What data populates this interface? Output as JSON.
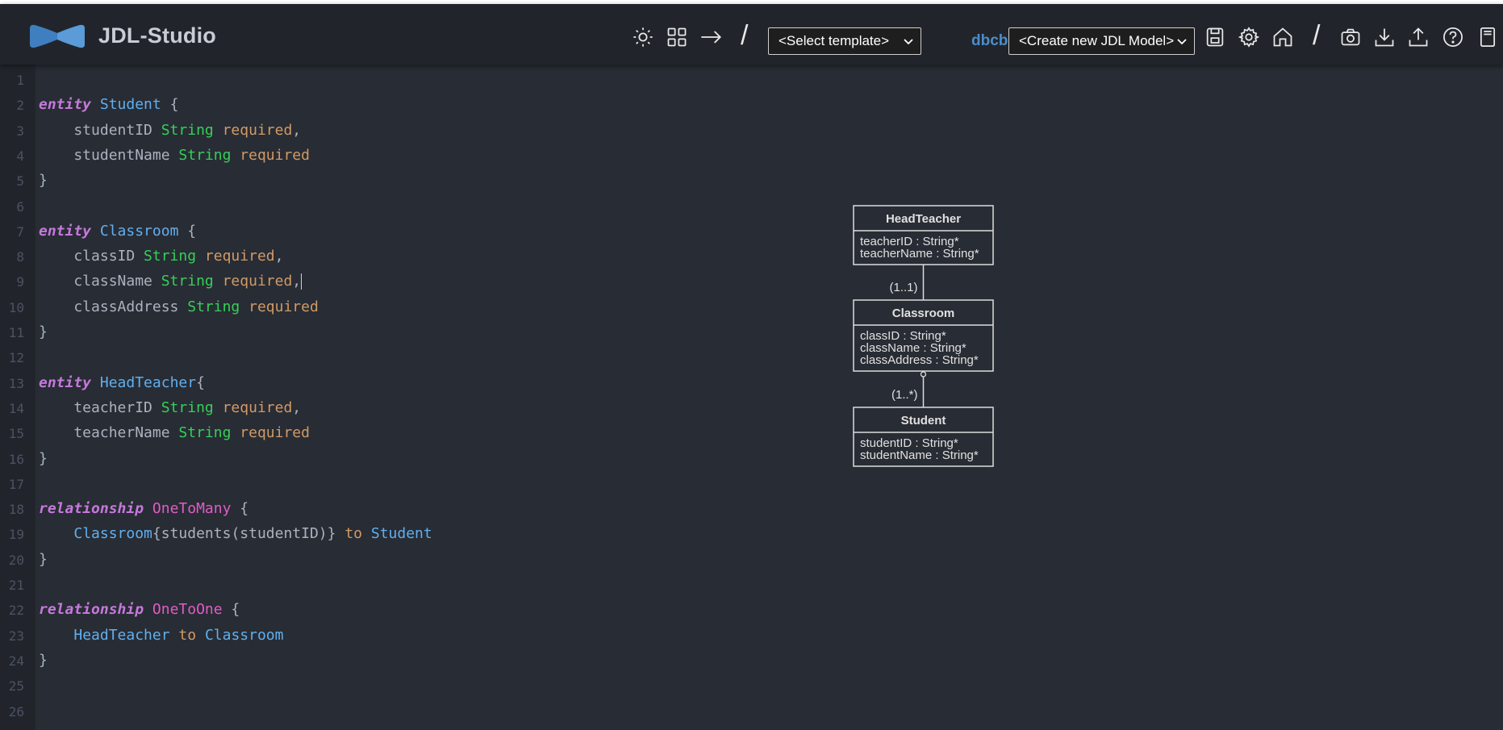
{
  "app": {
    "title": "JDL-Studio"
  },
  "toolbar": {
    "icons": [
      "sun-icon",
      "grid-icon",
      "arrow-right-icon"
    ],
    "template_select": "<Select template>",
    "user": "dbcb",
    "model_select": "<Create new JDL Model>",
    "right_icons": [
      "save-icon",
      "settings-icon",
      "home-icon",
      "camera-icon",
      "download-icon",
      "upload-icon",
      "help-icon",
      "sidebar-icon"
    ],
    "colors": {
      "header_bg": "#21252b",
      "editor_bg": "#282c34",
      "accent": "#4b8ecc"
    }
  },
  "editor": {
    "line_numbers": [
      "1",
      "2",
      "3",
      "4",
      "5",
      "6",
      "7",
      "8",
      "9",
      "10",
      "11",
      "12",
      "13",
      "14",
      "15",
      "16",
      "17",
      "18",
      "19",
      "20",
      "21",
      "22",
      "23",
      "24",
      "25",
      "26"
    ],
    "lines": [
      [],
      [
        {
          "t": "entity",
          "c": "kw"
        },
        {
          "t": " "
        },
        {
          "t": "Student",
          "c": "ent"
        },
        {
          "t": " {",
          "c": "br"
        }
      ],
      [
        {
          "t": "    studentID "
        },
        {
          "t": "String",
          "c": "typ"
        },
        {
          "t": " "
        },
        {
          "t": "required",
          "c": "req"
        },
        {
          "t": ","
        }
      ],
      [
        {
          "t": "    studentName "
        },
        {
          "t": "String",
          "c": "typ"
        },
        {
          "t": " "
        },
        {
          "t": "required",
          "c": "req"
        }
      ],
      [
        {
          "t": "}"
        }
      ],
      [],
      [
        {
          "t": "entity",
          "c": "kw"
        },
        {
          "t": " "
        },
        {
          "t": "Classroom",
          "c": "ent"
        },
        {
          "t": " {",
          "c": "br"
        }
      ],
      [
        {
          "t": "    classID "
        },
        {
          "t": "String",
          "c": "typ"
        },
        {
          "t": " "
        },
        {
          "t": "required",
          "c": "req"
        },
        {
          "t": ","
        }
      ],
      [
        {
          "t": "    className "
        },
        {
          "t": "String",
          "c": "typ"
        },
        {
          "t": " "
        },
        {
          "t": "required",
          "c": "req"
        },
        {
          "t": ","
        },
        {
          "cursor": true
        }
      ],
      [
        {
          "t": "    classAddress "
        },
        {
          "t": "String",
          "c": "typ"
        },
        {
          "t": " "
        },
        {
          "t": "required",
          "c": "req"
        }
      ],
      [
        {
          "t": "}"
        }
      ],
      [],
      [
        {
          "t": "entity",
          "c": "kw"
        },
        {
          "t": " "
        },
        {
          "t": "HeadTeacher",
          "c": "ent"
        },
        {
          "t": "{",
          "c": "br"
        }
      ],
      [
        {
          "t": "    teacherID "
        },
        {
          "t": "String",
          "c": "typ"
        },
        {
          "t": " "
        },
        {
          "t": "required",
          "c": "req"
        },
        {
          "t": ","
        }
      ],
      [
        {
          "t": "    teacherName "
        },
        {
          "t": "String",
          "c": "typ"
        },
        {
          "t": " "
        },
        {
          "t": "required",
          "c": "req"
        }
      ],
      [
        {
          "t": "}"
        }
      ],
      [],
      [
        {
          "t": "relationship",
          "c": "kw"
        },
        {
          "t": " "
        },
        {
          "t": "OneToMany",
          "c": "rel"
        },
        {
          "t": " {"
        }
      ],
      [
        {
          "t": "    "
        },
        {
          "t": "Classroom",
          "c": "ent"
        },
        {
          "t": "{students(studentID)} "
        },
        {
          "t": "to",
          "c": "to"
        },
        {
          "t": " "
        },
        {
          "t": "Student",
          "c": "ent"
        }
      ],
      [
        {
          "t": "}"
        }
      ],
      [],
      [
        {
          "t": "relationship",
          "c": "kw"
        },
        {
          "t": " "
        },
        {
          "t": "OneToOne",
          "c": "rel"
        },
        {
          "t": " {"
        }
      ],
      [
        {
          "t": "    "
        },
        {
          "t": "HeadTeacher",
          "c": "ent"
        },
        {
          "t": " "
        },
        {
          "t": "to",
          "c": "to"
        },
        {
          "t": " "
        },
        {
          "t": "Classroom",
          "c": "ent"
        }
      ],
      [
        {
          "t": "}"
        }
      ],
      [],
      []
    ]
  },
  "diagram": {
    "entities": [
      {
        "name": "HeadTeacher",
        "fields": [
          "teacherID : String*",
          "teacherName : String*"
        ]
      },
      {
        "name": "Classroom",
        "fields": [
          "classID : String*",
          "className : String*",
          "classAddress : String*"
        ]
      },
      {
        "name": "Student",
        "fields": [
          "studentID : String*",
          "studentName : String*"
        ]
      }
    ],
    "relations": [
      {
        "label": "(1..1)"
      },
      {
        "label": "(1..*)"
      }
    ]
  }
}
